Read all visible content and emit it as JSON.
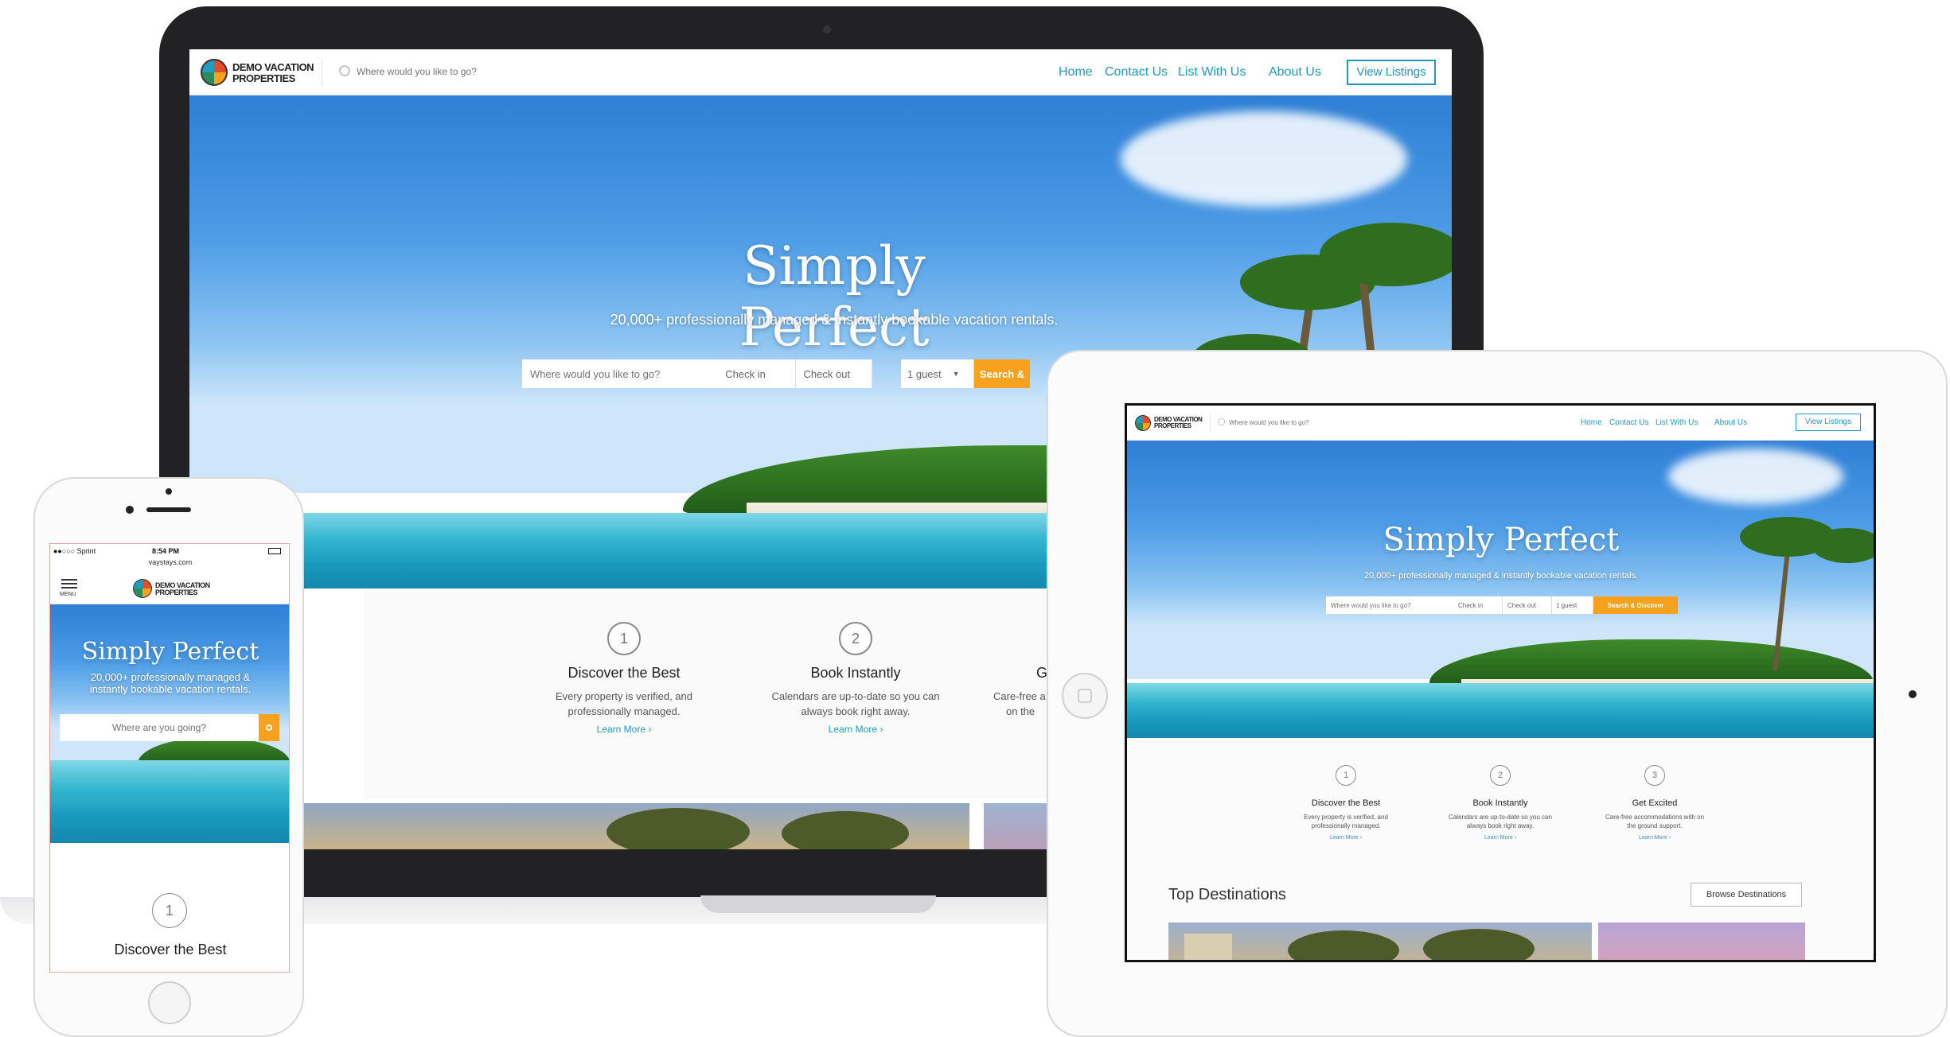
{
  "brand": {
    "line1": "DEMO VACATION",
    "line2": "PROPERTIES"
  },
  "nav": {
    "search_placeholder": "Where would you like to go?",
    "links": [
      "Home",
      "Contact Us",
      "List With Us",
      "About Us"
    ],
    "cta": "View Listings"
  },
  "hero": {
    "title": "Simply Perfect",
    "subtitle": "20,000+ professionally managed & instantly bookable vacation rentals.",
    "search": {
      "where_placeholder": "Where would you like to go?",
      "checkin": "Check in",
      "checkout": "Check out",
      "guests": "1 guest",
      "button_desktop": "Search &",
      "button_full": "Search & Discover"
    }
  },
  "steps": [
    {
      "num": "1",
      "title": "Discover the Best",
      "desc": "Every property is verified, and professionally managed.",
      "link": "Learn More ›"
    },
    {
      "num": "2",
      "title": "Book Instantly",
      "desc": "Calendars are up-to-date so you can always book right away.",
      "link": "Learn More ›"
    },
    {
      "num": "3",
      "title": "Get Excited",
      "desc": "Care-free accommodations with on the ground support.",
      "link": "Learn More ›"
    }
  ],
  "desktop_partial": {
    "step3_title": "G",
    "step3_line1": "Care-free a",
    "step3_line2": "on the"
  },
  "top_destinations": {
    "title": "Top Destinations",
    "button": "Browse Destinations"
  },
  "phone": {
    "carrier": "●●○○○ Sprint",
    "time": "8:54 PM",
    "url": "vaystays.com",
    "menu": "MENU",
    "search_placeholder": "Where are you going?",
    "step_num": "1",
    "step_title": "Discover the Best"
  },
  "colors": {
    "accent": "#1f9cc0",
    "button": "#f6a21e",
    "device_dark": "#222224"
  }
}
